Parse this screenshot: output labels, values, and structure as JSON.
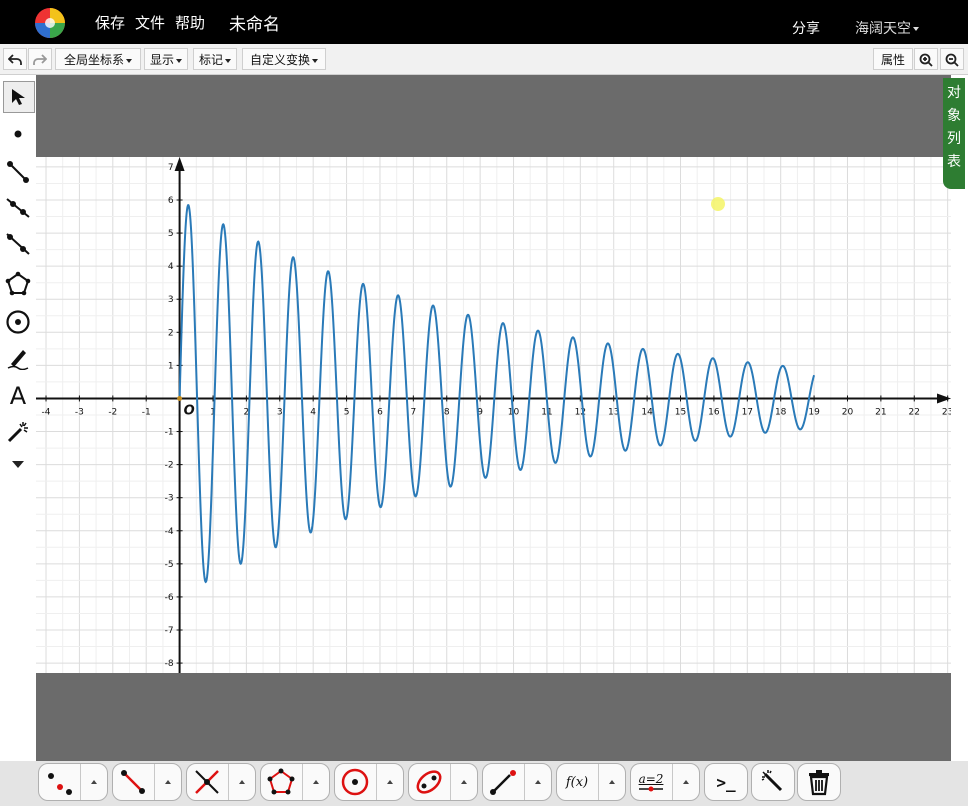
{
  "menu": {
    "save": "保存",
    "file": "文件",
    "help": "帮助",
    "title": "未命名",
    "share": "分享",
    "user": "海阔天空"
  },
  "toolbar": {
    "coord_system": "全局坐标系",
    "display": "显示",
    "mark": "标记",
    "custom_transform": "自定义变换",
    "properties": "属性"
  },
  "left_tools": [
    "select-arrow-icon",
    "point-icon",
    "segment-icon",
    "ray-icon",
    "line-icon",
    "polygon-icon",
    "circle-icon",
    "pen-icon",
    "text-icon",
    "magic-wand-icon",
    "more-icon"
  ],
  "left_tool_labels": {
    "text": "A"
  },
  "object_list": "对象列表",
  "bottom_tools": [
    "point-tools-icon",
    "segment-tools-icon",
    "intersection-tools-icon",
    "polygon-tools-icon",
    "circle-tools-icon",
    "conic-tools-icon",
    "transform-tools-icon",
    "function-tools-icon",
    "parameter-tools-icon",
    "command-icon",
    "magic-icon",
    "trash-icon"
  ],
  "bottom_labels": {
    "function": "f(x)",
    "parameter": "a=2",
    "command": ">_"
  },
  "colors": {
    "curve": "#2a7ab8",
    "object_list_bg": "#2e7d32",
    "workspace_gray": "#6b6b6b"
  },
  "chart_data": {
    "type": "line",
    "title": "",
    "xlabel": "",
    "ylabel": "",
    "origin_label": "O",
    "xlim": [
      -4.3,
      23.1
    ],
    "ylim": [
      -8.3,
      7.3
    ],
    "x_ticks": [
      -4,
      -3,
      -2,
      -1,
      1,
      2,
      3,
      4,
      5,
      6,
      7,
      8,
      9,
      10,
      11,
      12,
      13,
      14,
      15,
      16,
      17,
      18,
      19,
      20,
      21,
      22,
      23
    ],
    "y_ticks": [
      -8,
      -7,
      -6,
      -5,
      -4,
      -3,
      -2,
      -1,
      1,
      2,
      3,
      4,
      5,
      6,
      7
    ],
    "grid": true,
    "series": [
      {
        "kind": "damped-sine",
        "amplitude": 6,
        "decay": 0.1,
        "angular_frequency": 6.0,
        "x_range": [
          0,
          19
        ]
      }
    ]
  }
}
